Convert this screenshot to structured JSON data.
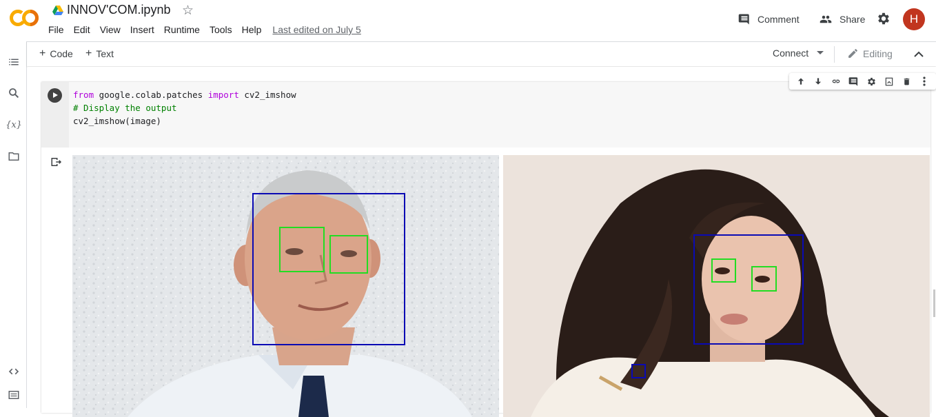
{
  "header": {
    "logo_text": "CO",
    "title": "INNOV'COM.ipynb",
    "menu": [
      "File",
      "Edit",
      "View",
      "Insert",
      "Runtime",
      "Tools",
      "Help"
    ],
    "last_edited": "Last edited on July 5",
    "comment_label": "Comment",
    "share_label": "Share",
    "avatar_initial": "H"
  },
  "toolbar": {
    "add_code": "Code",
    "add_text": "Text",
    "connect": "Connect",
    "editing": "Editing"
  },
  "rail": {
    "icons": [
      "table-of-contents-icon",
      "search-icon",
      "variables-icon",
      "files-icon",
      "code-snippets-icon",
      "command-palette-icon"
    ]
  },
  "cell": {
    "line1": {
      "kw1": "from",
      "mod": " google.colab.patches ",
      "kw2": "import",
      "name": " cv2_imshow"
    },
    "line2": "# Display the output",
    "line3": "cv2_imshow(image)",
    "tools": [
      "arrow-up-icon",
      "arrow-down-icon",
      "link-icon",
      "comment-icon",
      "gear-icon",
      "mirror-cell-icon",
      "delete-icon",
      "more-vert-icon"
    ]
  },
  "output": {
    "left_image": {
      "detections": {
        "faces": 1,
        "eyes": 2
      }
    },
    "right_image": {
      "detections": {
        "faces": 2,
        "eyes": 2
      }
    }
  },
  "colors": {
    "accent_orange": "#f9ab00",
    "face_box": "#0a0ab4",
    "eye_box": "#22dd22",
    "avatar": "#c1361f"
  }
}
